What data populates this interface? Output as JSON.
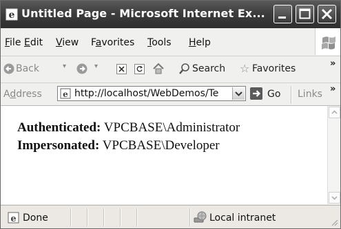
{
  "window": {
    "title": "Untitled Page - Microsoft Internet Ex..."
  },
  "menu": {
    "items": [
      {
        "label": "File",
        "mnemonic": "F",
        "rest": "ile"
      },
      {
        "label": "Edit",
        "mnemonic": "E",
        "rest": "dit"
      },
      {
        "label": "View",
        "mnemonic": "V",
        "rest": "iew"
      },
      {
        "label": "Favorites",
        "mnemonic": "a",
        "pre": "F",
        "rest": "vorites"
      },
      {
        "label": "Tools",
        "mnemonic": "T",
        "rest": "ools"
      },
      {
        "label": "Help",
        "mnemonic": "H",
        "rest": "elp"
      }
    ]
  },
  "toolbar": {
    "back_label": "Back",
    "search_label": "Search",
    "favorites_label": "Favorites"
  },
  "address": {
    "label_mnemonic": "d",
    "label_pre": "A",
    "label_rest": "dress",
    "url": "http://localhost/WebDemos/Te",
    "go_label": "Go",
    "links_label": "Links"
  },
  "content": {
    "authenticated_label": "Authenticated:",
    "authenticated_value": "VPCBASE\\Administrator",
    "impersonated_label": "Impersonated:",
    "impersonated_value": "VPCBASE\\Developer"
  },
  "status": {
    "text": "Done",
    "zone": "Local intranet"
  }
}
